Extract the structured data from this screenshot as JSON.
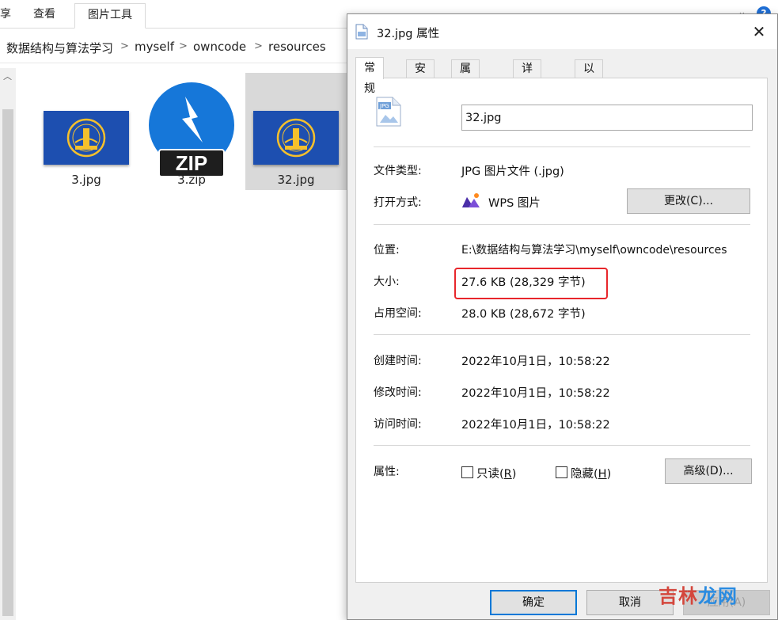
{
  "ribbon": {
    "tabs": [
      {
        "label": "享"
      },
      {
        "label": "查看"
      },
      {
        "label": "图片工具"
      }
    ],
    "help": "?"
  },
  "address": {
    "crumbs": [
      "数据结构与算法学习",
      "myself",
      "owncode",
      "resources"
    ],
    "separator": ">"
  },
  "files": [
    {
      "name": "3.jpg",
      "kind": "image-flag"
    },
    {
      "name": "3.zip",
      "kind": "zip",
      "badge": "ZIP"
    },
    {
      "name": "32.jpg",
      "kind": "image-flag",
      "selected": true
    }
  ],
  "dialog": {
    "title": "32.jpg 属性",
    "tabs": [
      "常规",
      "安全",
      "属性修改",
      "详细信息",
      "以前的版本"
    ],
    "active_tab": "常规",
    "filename": "32.jpg",
    "type_label": "文件类型:",
    "type_value": "JPG 图片文件 (.jpg)",
    "open_label": "打开方式:",
    "open_app": "WPS 图片",
    "change_button": "更改(C)...",
    "location_label": "位置:",
    "location_value": "E:\\数据结构与算法学习\\myself\\owncode\\resources",
    "size_label": "大小:",
    "size_value": "27.6 KB (28,329 字节)",
    "disk_label": "占用空间:",
    "disk_value": "28.0 KB (28,672 字节)",
    "created_label": "创建时间:",
    "created_value": "2022年10月1日，10:58:22",
    "modified_label": "修改时间:",
    "modified_value": "2022年10月1日，10:58:22",
    "accessed_label": "访问时间:",
    "accessed_value": "2022年10月1日，10:58:22",
    "attributes_label": "属性:",
    "readonly_text": "只读(",
    "readonly_key": "R",
    "hidden_text": "隐藏(",
    "hidden_key": "H",
    "advanced_button": "高级(D)...",
    "ok_button": "确定",
    "cancel_button": "取消",
    "apply_button": "应用(A)"
  },
  "watermark": {
    "part_a": "吉林",
    "part_b": "龙网"
  },
  "colors": {
    "accent": "#0078d7",
    "highlight": "#e8262b",
    "flag_blue": "#1d4fb0",
    "flag_gold": "#f5c02c"
  }
}
